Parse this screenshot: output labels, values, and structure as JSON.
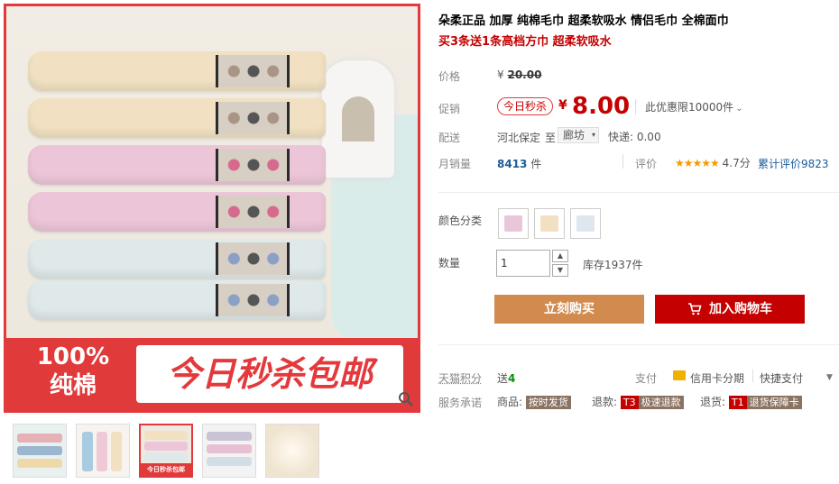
{
  "product": {
    "title": "朵柔正品 加厚 纯棉毛巾 超柔软吸水 情侣毛巾 全棉面巾",
    "subtitle": "买3条送1条高档方巾 超柔软吸水"
  },
  "main_image": {
    "promo_percent": "100%",
    "promo_material": "纯棉",
    "promo_banner": "今日秒杀包邮",
    "thumb_banner": "今日秒杀包邮"
  },
  "price": {
    "label": "价格",
    "currency": "¥",
    "original": "20.00",
    "promo_label": "促销",
    "promo_tag": "今日秒杀",
    "current": "8.00",
    "limit_note": "此优惠限10000件"
  },
  "shipping": {
    "label": "配送",
    "from": "河北保定",
    "to_word": "至",
    "city": "廊坊",
    "express": "快递: 0.00"
  },
  "sales": {
    "label": "月销量",
    "count": "8413",
    "unit": "件",
    "rating_label": "评价",
    "stars": "★★★★★",
    "score": "4.7分",
    "review_link": "累计评价9823"
  },
  "options": {
    "color_label": "颜色分类",
    "swatch_colors": [
      "#e9c7d9",
      "#f1e1c2",
      "#dfe6ef"
    ],
    "qty_label": "数量",
    "qty_value": "1",
    "stock": "库存1937件"
  },
  "actions": {
    "buy_now": "立刻购买",
    "add_to_cart": "加入购物车"
  },
  "extras": {
    "points_label": "天猫积分",
    "points_prefix": "送",
    "points_value": "4",
    "pay_label": "支付",
    "credit_card": "信用卡分期",
    "quick_pay": "快捷支付",
    "service_label": "服务承诺",
    "goods_label": "商品:",
    "goods_badge": "按时发货",
    "refund_label": "退款:",
    "refund_code": "T3",
    "refund_badge": "极速退款",
    "return_label": "退货:",
    "return_code": "T1",
    "return_badge": "退货保障卡"
  },
  "colors": {
    "accent_red": "#c40000",
    "buy_orange": "#d28b4f",
    "link_blue": "#1b5c9a"
  }
}
